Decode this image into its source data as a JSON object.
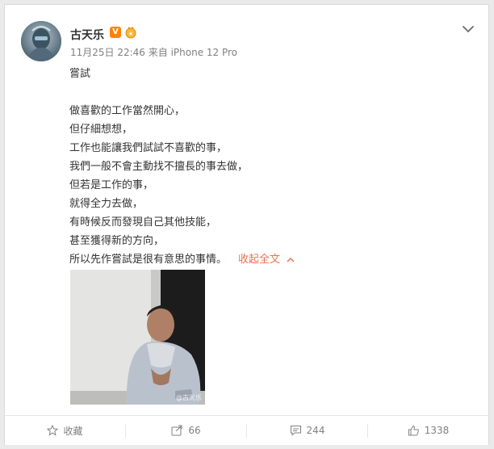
{
  "user": {
    "name": "古天乐",
    "verified_badge": "V",
    "medal_icon": "gold-medal-icon"
  },
  "meta": {
    "time": "11月25日 22:46",
    "source": "来自 iPhone 12 Pro"
  },
  "post": {
    "title": "嘗試",
    "lines": [
      "做喜歡的工作當然開心，",
      "但仔細想想，",
      "工作也能讓我們試試不喜歡的事，",
      "我們一般不會主動找不擅長的事去做，",
      "但若是工作的事，",
      "就得全力去做，",
      "有時候反而發現自己其他技能，",
      "甚至獲得新的方向，",
      "所以先作嘗試是很有意思的事情。"
    ],
    "collapse_label": "收起全文",
    "image_watermark": "@古天乐"
  },
  "actions": {
    "favorite": "收藏",
    "repost": "66",
    "comment": "244",
    "like": "1338"
  },
  "colors": {
    "accent": "#eb7350",
    "verified": "#ff8200",
    "muted_text": "#808080"
  }
}
